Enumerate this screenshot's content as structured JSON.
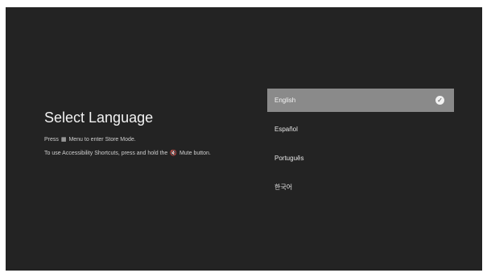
{
  "title": "Select Language",
  "instructions": {
    "line1_before": "Press",
    "line1_icon": "menu-icon",
    "line1_after": "Menu to enter Store Mode.",
    "line2_before": "To use Accessibility Shortcuts, press and hold the",
    "line2_icon": "mute-icon",
    "line2_after": "Mute button."
  },
  "languages": [
    {
      "label": "English",
      "selected": true
    },
    {
      "label": "Español",
      "selected": false
    },
    {
      "label": "Português",
      "selected": false
    },
    {
      "label": "한국어",
      "selected": false
    }
  ],
  "colors": {
    "background": "#232323",
    "selected": "#8a8a8a"
  }
}
